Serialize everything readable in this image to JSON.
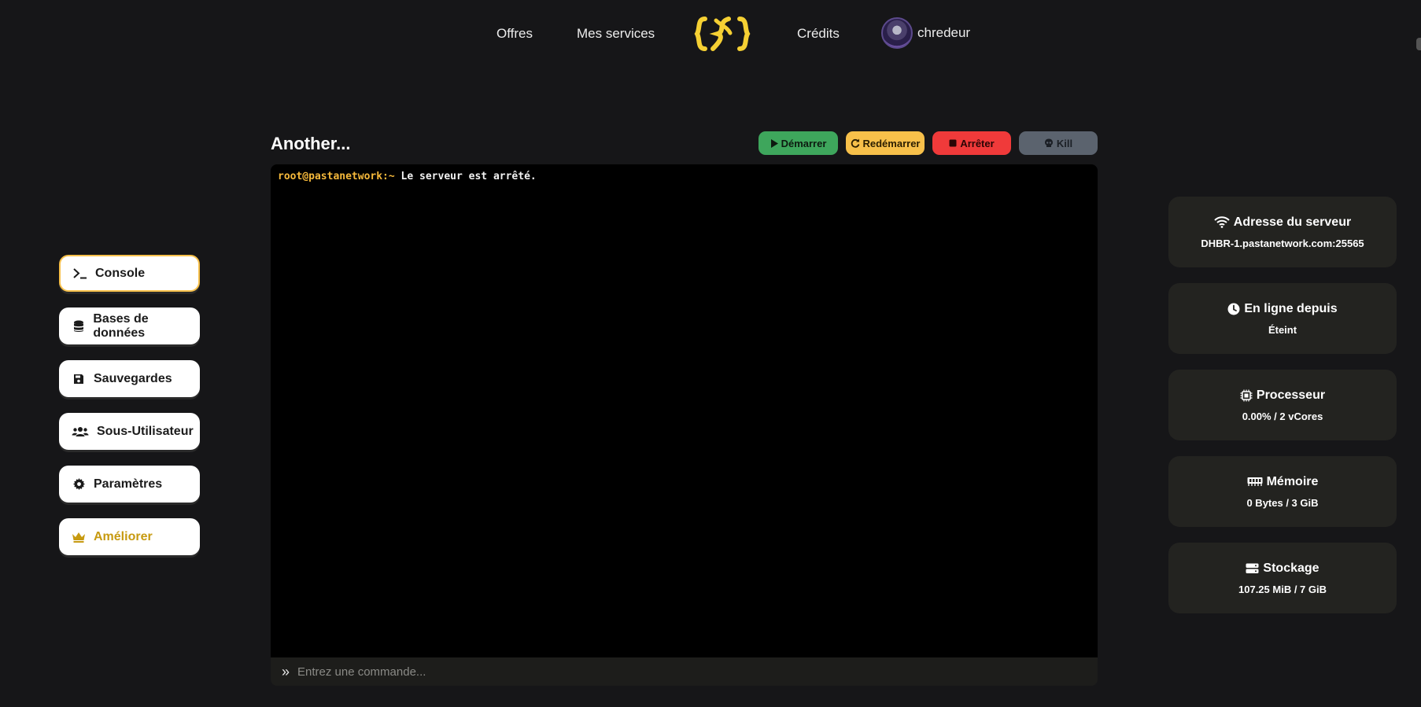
{
  "nav": {
    "offers": "Offres",
    "my_services": "Mes services",
    "credits": "Crédits",
    "username": "chredeur",
    "logo_icon": "pastanetwork-logo-icon"
  },
  "server": {
    "title": "Another..."
  },
  "actions": {
    "start": "Démarrer",
    "restart": "Redémarrer",
    "stop": "Arrêter",
    "kill": "Kill"
  },
  "console": {
    "prompt": "root@pastanetwork:~",
    "message": " Le serveur est arrêté.",
    "placeholder": "Entrez une commande..."
  },
  "sidebar": {
    "items": [
      {
        "label": "Console",
        "icon": "terminal-icon",
        "active": true
      },
      {
        "label": "Bases de données",
        "icon": "database-icon"
      },
      {
        "label": "Sauvegardes",
        "icon": "save-icon"
      },
      {
        "label": "Sous-Utilisateur",
        "icon": "users-icon"
      },
      {
        "label": "Paramètres",
        "icon": "gear-icon"
      },
      {
        "label": "Améliorer",
        "icon": "crown-icon"
      }
    ]
  },
  "stats": [
    {
      "title": "Adresse du serveur",
      "value": "DHBR-1.pastanetwork.com:25565",
      "icon": "wifi-icon"
    },
    {
      "title": "En ligne depuis",
      "value": "Éteint",
      "icon": "clock-icon"
    },
    {
      "title": "Processeur",
      "value": "0.00% / 2 vCores",
      "icon": "cpu-icon"
    },
    {
      "title": "Mémoire",
      "value": "0 Bytes / 3 GiB",
      "icon": "memory-icon"
    },
    {
      "title": "Stockage",
      "value": "107.25 MiB / 7 GiB",
      "icon": "storage-icon"
    }
  ],
  "colors": {
    "accent": "#f7c04a",
    "start": "#3ea65c",
    "stop": "#f03a3a",
    "kill": "#5b636e",
    "background": "#161618"
  }
}
